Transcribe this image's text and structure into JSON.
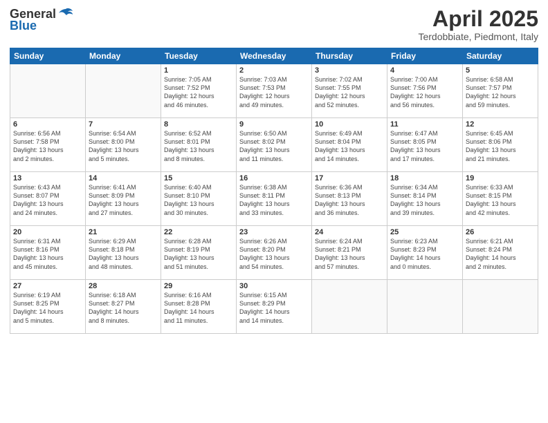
{
  "header": {
    "logo_general": "General",
    "logo_blue": "Blue",
    "title": "April 2025",
    "subtitle": "Terdobbiate, Piedmont, Italy"
  },
  "columns": [
    "Sunday",
    "Monday",
    "Tuesday",
    "Wednesday",
    "Thursday",
    "Friday",
    "Saturday"
  ],
  "weeks": [
    {
      "days": [
        {
          "num": "",
          "info": ""
        },
        {
          "num": "",
          "info": ""
        },
        {
          "num": "1",
          "info": "Sunrise: 7:05 AM\nSunset: 7:52 PM\nDaylight: 12 hours\nand 46 minutes."
        },
        {
          "num": "2",
          "info": "Sunrise: 7:03 AM\nSunset: 7:53 PM\nDaylight: 12 hours\nand 49 minutes."
        },
        {
          "num": "3",
          "info": "Sunrise: 7:02 AM\nSunset: 7:55 PM\nDaylight: 12 hours\nand 52 minutes."
        },
        {
          "num": "4",
          "info": "Sunrise: 7:00 AM\nSunset: 7:56 PM\nDaylight: 12 hours\nand 56 minutes."
        },
        {
          "num": "5",
          "info": "Sunrise: 6:58 AM\nSunset: 7:57 PM\nDaylight: 12 hours\nand 59 minutes."
        }
      ]
    },
    {
      "days": [
        {
          "num": "6",
          "info": "Sunrise: 6:56 AM\nSunset: 7:58 PM\nDaylight: 13 hours\nand 2 minutes."
        },
        {
          "num": "7",
          "info": "Sunrise: 6:54 AM\nSunset: 8:00 PM\nDaylight: 13 hours\nand 5 minutes."
        },
        {
          "num": "8",
          "info": "Sunrise: 6:52 AM\nSunset: 8:01 PM\nDaylight: 13 hours\nand 8 minutes."
        },
        {
          "num": "9",
          "info": "Sunrise: 6:50 AM\nSunset: 8:02 PM\nDaylight: 13 hours\nand 11 minutes."
        },
        {
          "num": "10",
          "info": "Sunrise: 6:49 AM\nSunset: 8:04 PM\nDaylight: 13 hours\nand 14 minutes."
        },
        {
          "num": "11",
          "info": "Sunrise: 6:47 AM\nSunset: 8:05 PM\nDaylight: 13 hours\nand 17 minutes."
        },
        {
          "num": "12",
          "info": "Sunrise: 6:45 AM\nSunset: 8:06 PM\nDaylight: 13 hours\nand 21 minutes."
        }
      ]
    },
    {
      "days": [
        {
          "num": "13",
          "info": "Sunrise: 6:43 AM\nSunset: 8:07 PM\nDaylight: 13 hours\nand 24 minutes."
        },
        {
          "num": "14",
          "info": "Sunrise: 6:41 AM\nSunset: 8:09 PM\nDaylight: 13 hours\nand 27 minutes."
        },
        {
          "num": "15",
          "info": "Sunrise: 6:40 AM\nSunset: 8:10 PM\nDaylight: 13 hours\nand 30 minutes."
        },
        {
          "num": "16",
          "info": "Sunrise: 6:38 AM\nSunset: 8:11 PM\nDaylight: 13 hours\nand 33 minutes."
        },
        {
          "num": "17",
          "info": "Sunrise: 6:36 AM\nSunset: 8:13 PM\nDaylight: 13 hours\nand 36 minutes."
        },
        {
          "num": "18",
          "info": "Sunrise: 6:34 AM\nSunset: 8:14 PM\nDaylight: 13 hours\nand 39 minutes."
        },
        {
          "num": "19",
          "info": "Sunrise: 6:33 AM\nSunset: 8:15 PM\nDaylight: 13 hours\nand 42 minutes."
        }
      ]
    },
    {
      "days": [
        {
          "num": "20",
          "info": "Sunrise: 6:31 AM\nSunset: 8:16 PM\nDaylight: 13 hours\nand 45 minutes."
        },
        {
          "num": "21",
          "info": "Sunrise: 6:29 AM\nSunset: 8:18 PM\nDaylight: 13 hours\nand 48 minutes."
        },
        {
          "num": "22",
          "info": "Sunrise: 6:28 AM\nSunset: 8:19 PM\nDaylight: 13 hours\nand 51 minutes."
        },
        {
          "num": "23",
          "info": "Sunrise: 6:26 AM\nSunset: 8:20 PM\nDaylight: 13 hours\nand 54 minutes."
        },
        {
          "num": "24",
          "info": "Sunrise: 6:24 AM\nSunset: 8:21 PM\nDaylight: 13 hours\nand 57 minutes."
        },
        {
          "num": "25",
          "info": "Sunrise: 6:23 AM\nSunset: 8:23 PM\nDaylight: 14 hours\nand 0 minutes."
        },
        {
          "num": "26",
          "info": "Sunrise: 6:21 AM\nSunset: 8:24 PM\nDaylight: 14 hours\nand 2 minutes."
        }
      ]
    },
    {
      "days": [
        {
          "num": "27",
          "info": "Sunrise: 6:19 AM\nSunset: 8:25 PM\nDaylight: 14 hours\nand 5 minutes."
        },
        {
          "num": "28",
          "info": "Sunrise: 6:18 AM\nSunset: 8:27 PM\nDaylight: 14 hours\nand 8 minutes."
        },
        {
          "num": "29",
          "info": "Sunrise: 6:16 AM\nSunset: 8:28 PM\nDaylight: 14 hours\nand 11 minutes."
        },
        {
          "num": "30",
          "info": "Sunrise: 6:15 AM\nSunset: 8:29 PM\nDaylight: 14 hours\nand 14 minutes."
        },
        {
          "num": "",
          "info": ""
        },
        {
          "num": "",
          "info": ""
        },
        {
          "num": "",
          "info": ""
        }
      ]
    }
  ]
}
